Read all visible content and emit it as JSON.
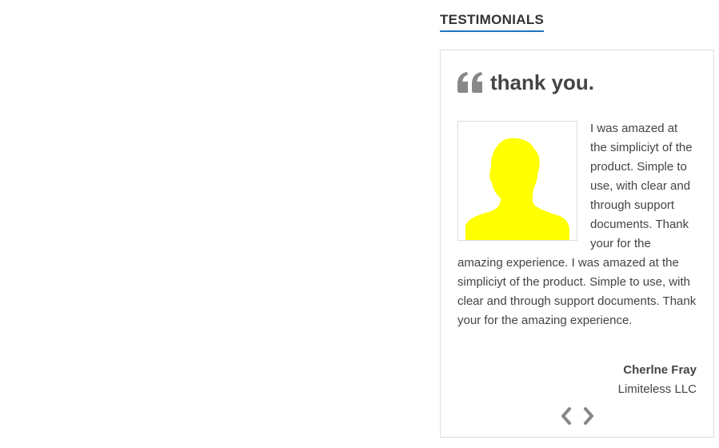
{
  "widget": {
    "title": "TESTIMONIALS"
  },
  "testimonial": {
    "heading": "thank you.",
    "photo_icon": "person-silhouette",
    "photo_color": "#ffff00",
    "body": "I was amazed at the simpliciyt of the product. Simple to use, with clear and through support documents. Thank your for the amazing experience. I was amazed at the simpliciyt of the product. Simple to use, with clear and through support documents. Thank your for the amazing experience.",
    "author_name": "Cherlne Fray",
    "author_company": "Limiteless LLC"
  },
  "navigation": {
    "prev_icon": "chevron-left-icon",
    "next_icon": "chevron-right-icon"
  },
  "colors": {
    "accent": "#1e73be",
    "text": "#444444",
    "icon": "#888888",
    "border": "#dddddd"
  }
}
